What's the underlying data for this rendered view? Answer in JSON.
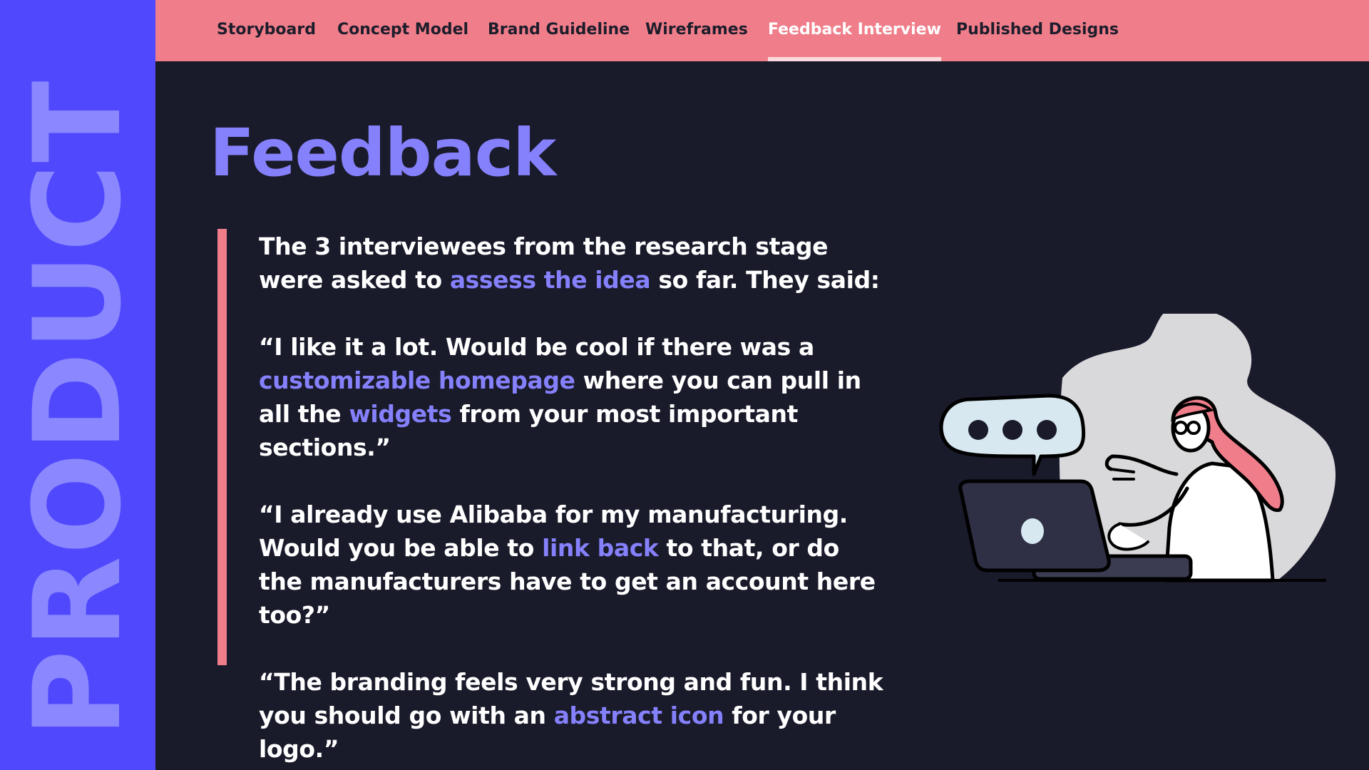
{
  "sidebar": {
    "label": "PRODUCT"
  },
  "nav": {
    "tabs": [
      {
        "label": "Storyboard",
        "active": false
      },
      {
        "label": "Concept Model",
        "active": false
      },
      {
        "label": "Brand Guideline",
        "active": false
      },
      {
        "label": "Wireframes",
        "active": false
      },
      {
        "label": "Feedback Interview",
        "active": true
      },
      {
        "label": "Published Designs",
        "active": false
      }
    ]
  },
  "page": {
    "title": "Feedback",
    "intro": {
      "a": "The 3 interviewees from the research stage were asked to ",
      "b": "assess the idea",
      "c": " so far. They said:"
    },
    "quotes": [
      {
        "a": "“I like it a lot. Would be cool if there was a ",
        "b": "customizable homepage",
        "c": " where you can pull in all the ",
        "d": "widgets",
        "e": " from your most important sections.”"
      },
      {
        "a": "“I already use Alibaba for my manufacturing. Would you be able to ",
        "b": "link back",
        "c": " to that, or do the manufacturers have to get an account here too?”"
      },
      {
        "a": "“The branding feels very strong and fun. I think you should go with an ",
        "b": "abstract icon",
        "c": " for your logo.”"
      }
    ]
  },
  "colors": {
    "sidebar_bg": "#5048fc",
    "sidebar_text": "#8a87ff",
    "nav_bg": "#ef7e8a",
    "page_bg": "#191a2a",
    "accent": "#8580fb",
    "quote_bar": "#ef7e8a"
  },
  "illustration": {
    "icon": "person-with-laptop-and-chat-bubble-illustration"
  }
}
